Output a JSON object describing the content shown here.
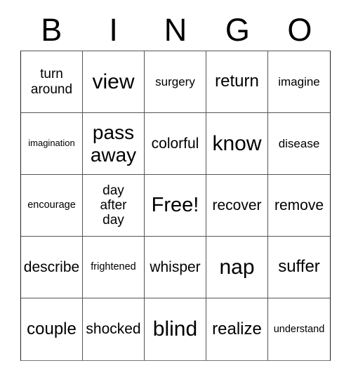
{
  "card": {
    "title": "BINGO",
    "header_letters": [
      "B",
      "I",
      "N",
      "G",
      "O"
    ],
    "columns": 5,
    "rows": 5,
    "free_space": {
      "label": "Free!",
      "row": 3,
      "column": 3
    },
    "colors": {
      "background": "#ffffff",
      "cell_background": "#ffffff",
      "text": "#000000",
      "grid_line": "#555555",
      "outer_border": "#222222"
    },
    "cells": [
      {
        "text": "turn\naround",
        "size": "lg",
        "lines": 2
      },
      {
        "text": "view",
        "size": "4xl",
        "lines": 1
      },
      {
        "text": "surgery",
        "size": "md",
        "lines": 1
      },
      {
        "text": "return",
        "size": "2xl",
        "lines": 1
      },
      {
        "text": "imagine",
        "size": "md",
        "lines": 1
      },
      {
        "text": "imagination",
        "size": "xs",
        "lines": 1
      },
      {
        "text": "pass\naway",
        "size": "3xl",
        "lines": 2
      },
      {
        "text": "colorful",
        "size": "xl",
        "lines": 1
      },
      {
        "text": "know",
        "size": "4xl",
        "lines": 1
      },
      {
        "text": "disease",
        "size": "md",
        "lines": 1
      },
      {
        "text": "encourage",
        "size": "sm",
        "lines": 1
      },
      {
        "text": "day\nafter\nday",
        "size": "lg",
        "lines": 3
      },
      {
        "text": "Free!",
        "size": "free",
        "lines": 1
      },
      {
        "text": "recover",
        "size": "xl",
        "lines": 1
      },
      {
        "text": "remove",
        "size": "xl",
        "lines": 1
      },
      {
        "text": "describe",
        "size": "xl",
        "lines": 1
      },
      {
        "text": "frightened",
        "size": "sm",
        "lines": 1
      },
      {
        "text": "whisper",
        "size": "xl",
        "lines": 1
      },
      {
        "text": "nap",
        "size": "4xl",
        "lines": 1
      },
      {
        "text": "suffer",
        "size": "2xl",
        "lines": 1
      },
      {
        "text": "couple",
        "size": "2xl",
        "lines": 1
      },
      {
        "text": "shocked",
        "size": "xl",
        "lines": 1
      },
      {
        "text": "blind",
        "size": "4xl",
        "lines": 1
      },
      {
        "text": "realize",
        "size": "2xl",
        "lines": 1
      },
      {
        "text": "understand",
        "size": "sm",
        "lines": 1
      }
    ]
  }
}
